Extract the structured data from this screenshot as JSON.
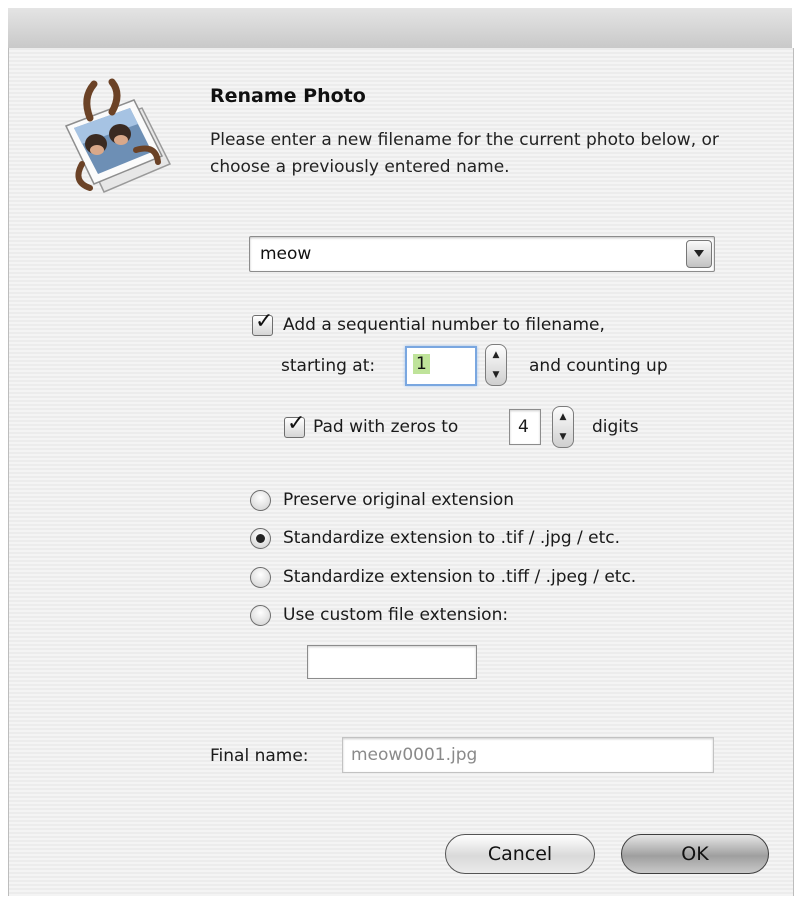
{
  "dialog": {
    "title": "Rename Photo",
    "description": "Please enter a new filename for the current photo below, or choose a previously entered name."
  },
  "filename_combo": {
    "value": "meow",
    "arrow_icon": "chevron-down-icon"
  },
  "sequential": {
    "checked": true,
    "label": "Add a sequential number to filename,",
    "starting_at_label": "starting at:",
    "start_value": "1",
    "counting_up_label": "and counting up"
  },
  "pad": {
    "checked": true,
    "label": "Pad with zeros to",
    "value": "4",
    "suffix_label": "digits"
  },
  "extension_options": [
    {
      "label": "Preserve original extension",
      "selected": false
    },
    {
      "label": "Standardize extension to .tif / .jpg / etc.",
      "selected": true
    },
    {
      "label": "Standardize extension to .tiff / .jpeg / etc.",
      "selected": false
    },
    {
      "label": "Use custom file extension:",
      "selected": false
    }
  ],
  "custom_extension": {
    "value": ""
  },
  "final_name": {
    "label": "Final name:",
    "value": "meow0001.jpg"
  },
  "buttons": {
    "cancel": "Cancel",
    "ok": "OK"
  }
}
